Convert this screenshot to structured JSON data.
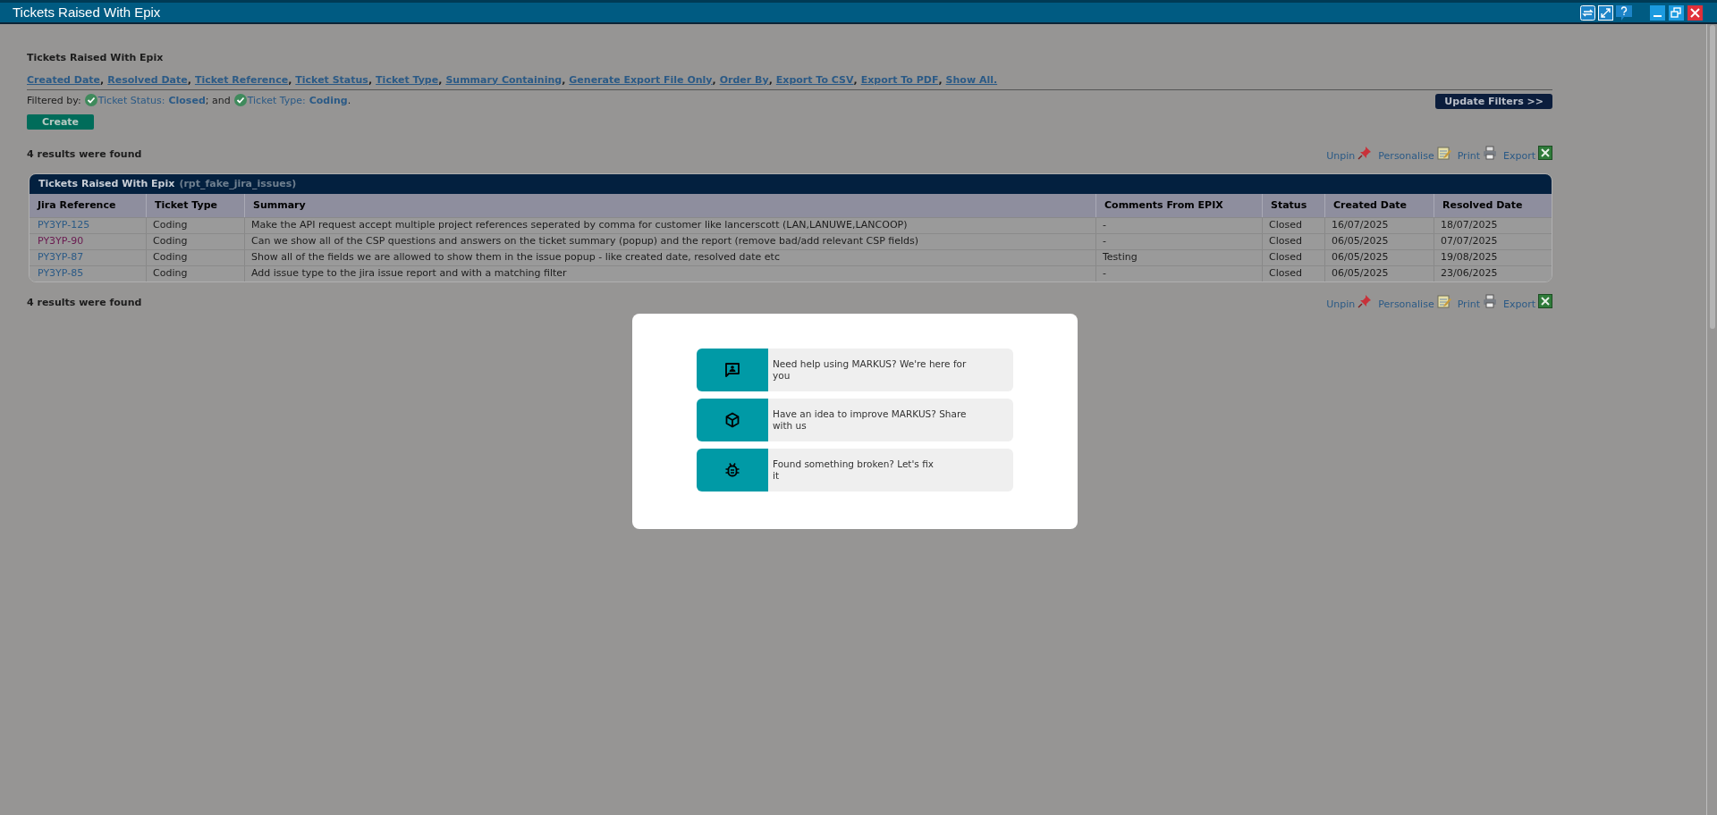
{
  "window": {
    "title": "Tickets Raised With Epix"
  },
  "page_title": "Tickets Raised With Epix",
  "filter_links": [
    {
      "label": "Created Date",
      "after": ","
    },
    {
      "label": "Resolved Date",
      "after": ","
    },
    {
      "label": "Ticket Reference",
      "after": ","
    },
    {
      "label": "Ticket Status",
      "after": ","
    },
    {
      "label": "Ticket Type",
      "after": ","
    },
    {
      "label": "Summary Containing",
      "after": ","
    },
    {
      "label": "Generate Export File Only",
      "after": ","
    },
    {
      "label": "Order By",
      "after": ","
    },
    {
      "label": "Export To CSV",
      "after": ","
    },
    {
      "label": "Export To PDF",
      "after": ","
    },
    {
      "label": "Show All."
    }
  ],
  "filtered_by": {
    "label": "Filtered by:",
    "filters": [
      {
        "label": "Ticket Status:",
        "value": "Closed",
        "after": "; and"
      },
      {
        "label": "Ticket Type:",
        "value": "Coding",
        "after": "."
      }
    ]
  },
  "update_filters_button": "Update Filters >>",
  "create_button": "Create",
  "results_top": "4 results were found",
  "results_bottom": "4 results were found",
  "toolbar_top": [
    "Unpin",
    "Personalise",
    "Print",
    "Export"
  ],
  "toolbar_bottom": [
    "Unpin",
    "Personalise",
    "Print",
    "Export"
  ],
  "table": {
    "title": "Tickets Raised With Epix",
    "subtitle": "(rpt_fake_jira_issues)",
    "columns": [
      "Jira Reference",
      "Ticket Type",
      "Summary",
      "Comments From EPIX",
      "Status",
      "Created Date",
      "Resolved Date"
    ],
    "rows": [
      {
        "visited": false,
        "cells": [
          "PY3YP-125",
          "Coding",
          "Make the API request accept multiple project references seperated by comma for customer like lancerscott (LAN,LANUWE,LANCOOP)",
          "-",
          "Closed",
          "16/07/2025",
          "18/07/2025"
        ]
      },
      {
        "visited": true,
        "cells": [
          "PY3YP-90",
          "Coding",
          "Can we show all of the CSP questions and answers on the ticket summary (popup) and the report (remove bad/add relevant CSP fields)",
          "-",
          "Closed",
          "06/05/2025",
          "07/07/2025"
        ]
      },
      {
        "visited": false,
        "cells": [
          "PY3YP-87",
          "Coding",
          "Show all of the fields we are allowed to show them in the issue popup - like created date, resolved date etc",
          "Testing",
          "Closed",
          "06/05/2025",
          "19/08/2025"
        ]
      },
      {
        "visited": false,
        "cells": [
          "PY3YP-85",
          "Coding",
          "Add issue type to the jira issue report and with a matching filter",
          "-",
          "Closed",
          "06/05/2025",
          "23/06/2025"
        ]
      }
    ]
  },
  "dialog": {
    "options": [
      {
        "kind": "help",
        "text": "Need help using MARKUS? We're here for you"
      },
      {
        "kind": "idea",
        "text": "Have an idea to improve MARKUS? Share with us"
      },
      {
        "kind": "bug",
        "text": "Found something broken? Let's fix\nit"
      }
    ]
  }
}
